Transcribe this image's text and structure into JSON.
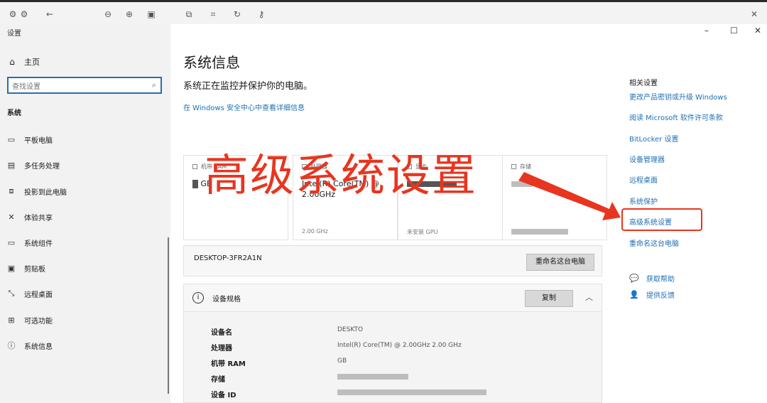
{
  "viewer": {
    "icons": [
      "settings-icon",
      "settings-alt-icon",
      "back-arrow-icon",
      "zoom-out-icon",
      "zoom-in-icon",
      "fit-screen-icon",
      "crop-icon",
      "select-icon",
      "rotate-icon",
      "key-icon"
    ]
  },
  "window": {
    "title": "设置",
    "controls": {
      "minimize": "–",
      "maximize": "☐",
      "close": "✕"
    }
  },
  "sidebar": {
    "home": "主页",
    "search_placeholder": "查找设置",
    "section": "系统",
    "items": [
      {
        "label": "平板电脑",
        "icon": "tablet-icon"
      },
      {
        "label": "多任务处理",
        "icon": "multitask-icon"
      },
      {
        "label": "投影到此电脑",
        "icon": "project-icon"
      },
      {
        "label": "体验共享",
        "icon": "share-icon"
      },
      {
        "label": "系统组件",
        "icon": "component-icon"
      },
      {
        "label": "剪贴板",
        "icon": "clipboard-icon"
      },
      {
        "label": "远程桌面",
        "icon": "remote-icon"
      },
      {
        "label": "可选功能",
        "icon": "features-icon"
      },
      {
        "label": "系统信息",
        "icon": "info-icon"
      }
    ]
  },
  "main": {
    "title": "系统信息",
    "subtitle": "系统正在监控并保护你的电脑。",
    "security_link": "在 Windows 安全中心中查看详细信息",
    "cards": [
      {
        "title": "机带 RAM",
        "value": "GB",
        "footer": ""
      },
      {
        "title": "处理器",
        "value": "Intel(R) Core(TM) @ 2.00GHz",
        "footer": "2.00 GHz"
      },
      {
        "title": "显卡",
        "value": "",
        "footer": "未安装 GPU"
      },
      {
        "title": "存储",
        "value": "",
        "footer": ""
      }
    ],
    "pc_name": "DESKTOP-3FR2A1N",
    "rename_button": "重命名这台电脑",
    "spec_title": "设备规格",
    "copy_button": "复制",
    "specs": [
      {
        "key": "设备名",
        "value": "DESKTO"
      },
      {
        "key": "处理器",
        "value": "Intel(R) Core(TM)   @ 2.00GHz   2.00 GHz"
      },
      {
        "key": "机带 RAM",
        "value": "GB"
      },
      {
        "key": "存储",
        "value": ""
      },
      {
        "key": "设备 ID",
        "value": ""
      }
    ]
  },
  "related": {
    "heading": "相关设置",
    "links": [
      "更改产品密钥或升级 Windows",
      "阅读 Microsoft 软件许可条款",
      "BitLocker 设置",
      "设备管理器",
      "远程桌面",
      "系统保护",
      "高级系统设置",
      "重命名这台电脑"
    ],
    "help": [
      {
        "label": "获取帮助",
        "icon": "help-chat-icon"
      },
      {
        "label": "提供反馈",
        "icon": "feedback-icon"
      }
    ]
  },
  "annotation": {
    "text": "高级系统设置",
    "color": "#e8351f"
  }
}
